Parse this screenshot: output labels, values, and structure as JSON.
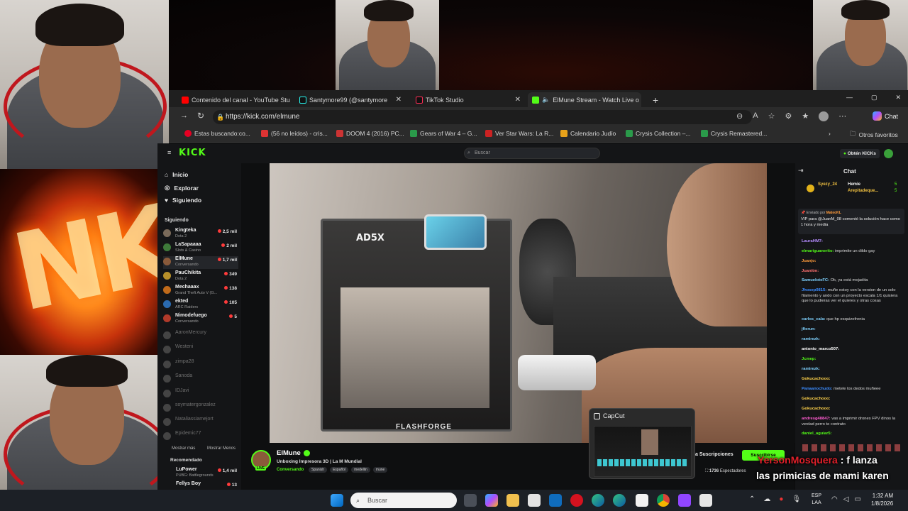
{
  "browser": {
    "tabs": [
      {
        "title": "Contenido del canal - YouTube Stu",
        "icon": "youtube-icon"
      },
      {
        "title": "Santymore99 (@santymore",
        "icon": "tiktok-icon"
      },
      {
        "title": "TikTok Studio",
        "icon": "tiktok-icon"
      },
      {
        "title": "ElMune Stream - Watch Live o",
        "icon": "kick-icon"
      }
    ],
    "new_tab": "+",
    "url": "https://kick.com/elmune",
    "chat_button": "Chat",
    "bookmarks": [
      "Estas buscando:co...",
      "(56 no leídos) - cris...",
      "DOOM 4 (2016) PC...",
      "Gears of War 4 – G...",
      "Ver Star Wars: La R...",
      "Calendario Judío",
      "Crysis Collection –...",
      "Crysis Remastered..."
    ],
    "other_favorites": "Otros favoritos"
  },
  "kick": {
    "logo": "KICK",
    "search_placeholder": "Buscar",
    "get_kicks": "Obtén KICKs",
    "nav": [
      "Inicio",
      "Explorar",
      "Siguiendo"
    ],
    "following_heading": "Siguiendo",
    "channels": [
      {
        "name": "Kingteka",
        "game": "Dota 2",
        "viewers": "2,5 mil",
        "color": "#7a6a5a"
      },
      {
        "name": "LaSapaaaa",
        "game": "Slots & Casino",
        "viewers": "2 mil",
        "color": "#3e7a3a"
      },
      {
        "name": "ElMune",
        "game": "Conversando",
        "viewers": "1,7 mil",
        "color": "#8a5a3a"
      },
      {
        "name": "PauChikita",
        "game": "Dota 2",
        "viewers": "349",
        "color": "#b8902a"
      },
      {
        "name": "Mechaaax",
        "game": "Grand Theft Auto V (G...",
        "viewers": "138",
        "color": "#c06a1a"
      },
      {
        "name": "ekted",
        "game": "ARC Raiders",
        "viewers": "105",
        "color": "#2a6ab0"
      },
      {
        "name": "Nimodefuego",
        "game": "Conversando",
        "viewers": "5",
        "color": "#b03a2a"
      }
    ],
    "offline_channels": [
      "AaronMercury",
      "Westeni",
      "zimpa28",
      "Sanoda",
      "IDJavi",
      "soymatergonzalez",
      "Nataliassiamejort",
      "Epidemic77"
    ],
    "show_more": "Mostrar más",
    "show_less": "Mostrar Menos",
    "recommended": "Recomendado",
    "recommended_channels": [
      {
        "name": "LuPower",
        "game": "PUBG: Battlegrounds",
        "viewers": "1,4 mil"
      },
      {
        "name": "Fellys Boy",
        "game": "",
        "viewers": "13"
      }
    ],
    "streamer": {
      "name": "ElMune",
      "title": "Unboxing Impresora 3D | La M Mundial",
      "category": "Conversando",
      "tags": [
        "Spanish",
        "Español",
        "medellin",
        "mune"
      ],
      "live": "LIVE",
      "viewers": "1736",
      "viewers_label": "Espectadores",
      "subscribe_tab": "a Suscripciones",
      "subscribe_btn": "Suscribirse"
    },
    "video_label": "AD5X",
    "video_brand": "FLASHFORGE"
  },
  "chat": {
    "title": "Chat",
    "leaderboard": [
      {
        "name": "Syezy_24",
        "pts": "5"
      },
      {
        "name": "Hemie",
        "pts": "5"
      },
      {
        "name": "Arepitadeque...",
        "pts": "5"
      }
    ],
    "pinned_sender": "Enviado por",
    "pinned_user": "MateoKL",
    "pinned_text": "VIP para @JuanM_08 comentó la solución hace como 1 hora y media",
    "messages": [
      {
        "user": "LauraHM7:",
        "text": ""
      },
      {
        "user": "elmariguanerito:",
        "text": "imprimite un dildo gay"
      },
      {
        "user": "Juanjo:",
        "text": ""
      },
      {
        "user": "Juanitm:",
        "text": ""
      },
      {
        "user": "SamueloteFC:",
        "text": "Ok, ya está mojadita"
      },
      {
        "user": "Jhosep0815:",
        "text": "muñe estoy con la version de un solo filamento y ando con un proyecto escala 1/1 quisiera que lo pudieras ver el quieres y otras cosas"
      },
      {
        "user": "carlos_cala:",
        "text": "que hp esquizofrenia"
      },
      {
        "user": "jfierun:",
        "text": ""
      },
      {
        "user": "ramirezk:",
        "text": ""
      },
      {
        "user": "antonio_marco507:",
        "text": ""
      },
      {
        "user": "Jcmep:",
        "text": ""
      },
      {
        "user": "ramirezk:",
        "text": ""
      },
      {
        "user": "Gokucachooo:",
        "text": ""
      },
      {
        "user": "Panaanochudo:",
        "text": "metele los dedos muñeee"
      },
      {
        "user": "Gokucachooo:",
        "text": ""
      },
      {
        "user": "Gokucachooo:",
        "text": ""
      },
      {
        "user": "andresg48847:",
        "text": "vas a imprimir drones FPV dinos la verdad perro te contrato"
      },
      {
        "user": "daniel_aguiar5:",
        "text": ""
      }
    ]
  },
  "overlay": {
    "capcut_title": "CapCut",
    "caption_user": "YersonMosquera",
    "caption_text1": ": f lanza",
    "caption_text2": "las primicias de mami karen"
  },
  "taskbar": {
    "search_placeholder": "Buscar",
    "lang": "ESP",
    "lang2": "LAA",
    "time": "1:32 AM",
    "date": "1/8/2026"
  }
}
